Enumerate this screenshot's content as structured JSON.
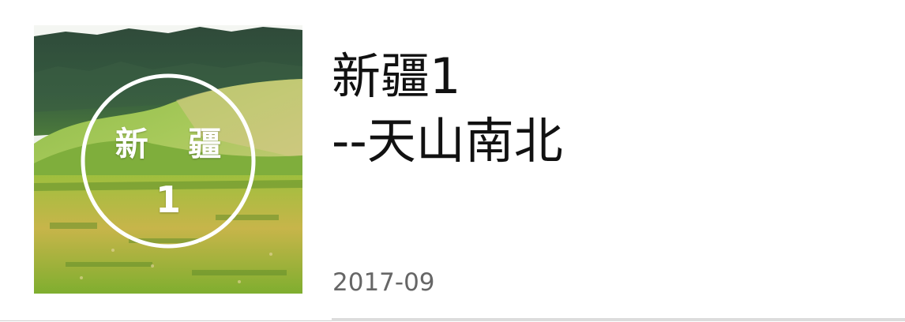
{
  "article": {
    "thumbnail": {
      "badge_line1": "新 疆",
      "badge_line2": "1"
    },
    "title_line1": "新疆1",
    "title_line2": "--天山南北",
    "date": "2017-09"
  }
}
